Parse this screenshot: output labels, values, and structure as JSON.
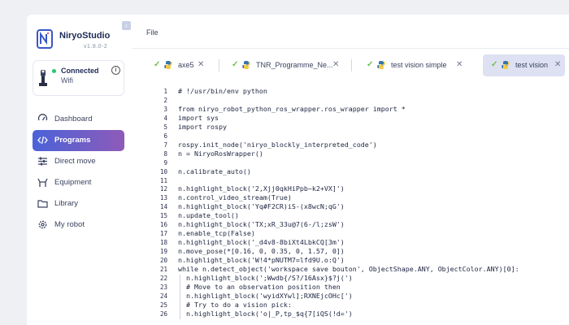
{
  "brand": {
    "name": "NiryoStudio",
    "version": "v1.8.0-2"
  },
  "connection": {
    "status": "Connected",
    "type": "Wifi"
  },
  "nav": [
    {
      "label": "Dashboard",
      "icon": "dashboard-icon",
      "active": false
    },
    {
      "label": "Programs",
      "icon": "code-icon",
      "active": true
    },
    {
      "label": "Direct move",
      "icon": "sliders-icon",
      "active": false
    },
    {
      "label": "Equipment",
      "icon": "gripper-icon",
      "active": false
    },
    {
      "label": "Library",
      "icon": "folder-icon",
      "active": false
    },
    {
      "label": "My robot",
      "icon": "gear-icon",
      "active": false
    }
  ],
  "menu": {
    "file": "File"
  },
  "tabs": [
    {
      "label": "axe5",
      "active": false
    },
    {
      "label": "TNR_Programme_Ne...",
      "active": false
    },
    {
      "label": "test vision simple",
      "active": false
    },
    {
      "label": "test vision",
      "active": true
    }
  ],
  "code": {
    "lines": [
      {
        "n": "1",
        "text": "# !/usr/bin/env python"
      },
      {
        "n": "2",
        "text": ""
      },
      {
        "n": "3",
        "text": "from niryo_robot_python_ros_wrapper.ros_wrapper import *"
      },
      {
        "n": "4",
        "text": "import sys"
      },
      {
        "n": "5",
        "text": "import rospy"
      },
      {
        "n": "6",
        "text": ""
      },
      {
        "n": "7",
        "text": "rospy.init_node('niryo_blockly_interpreted_code')"
      },
      {
        "n": "8",
        "text": "n = NiryoRosWrapper()"
      },
      {
        "n": "9",
        "text": ""
      },
      {
        "n": "10",
        "text": "n.calibrate_auto()"
      },
      {
        "n": "11",
        "text": ""
      },
      {
        "n": "12",
        "text": "n.highlight_block('2,Xjj0qkHiPpb~k2+VX]')"
      },
      {
        "n": "13",
        "text": "n.control_video_stream(True)"
      },
      {
        "n": "14",
        "text": "n.highlight_block('Yq#F2CR)iS-(x8wcN;qG')"
      },
      {
        "n": "15",
        "text": "n.update_tool()"
      },
      {
        "n": "16",
        "text": "n.highlight_block('TX;xR_33u@7(6-/l;zsW')"
      },
      {
        "n": "17",
        "text": "n.enable_tcp(False)"
      },
      {
        "n": "18",
        "text": "n.highlight_block('_d4v8-8biXt4LbkCQ[3m')"
      },
      {
        "n": "19",
        "text": "n.move_pose(*[0.16, 0, 0.35, 0, 1.57, 0])"
      },
      {
        "n": "20",
        "text": "n.highlight_block('W!4*pNUTM7=lfd9U.o:Q')"
      },
      {
        "n": "21",
        "text": "while n.detect_object('workspace save bouton', ObjectShape.ANY, ObjectColor.ANY)[0]:"
      },
      {
        "n": "22",
        "text": "  n.highlight_block(';Wwdb{/S?/16Asx}$?j(')"
      },
      {
        "n": "23",
        "text": "  # Move to an observation position then"
      },
      {
        "n": "24",
        "text": "  n.highlight_block('wyidXYwl];RXNEjcOHc[')"
      },
      {
        "n": "25",
        "text": "  # Try to do a vision pick:"
      },
      {
        "n": "26",
        "text": "  n.highlight_block('o|_P,tp_$q{7[iQS(!d=')"
      }
    ]
  },
  "colors": {
    "accent_start": "#4b62d8",
    "accent_end": "#8e5bb8",
    "connected": "#28c76f",
    "tab_check": "#6cc04a"
  }
}
